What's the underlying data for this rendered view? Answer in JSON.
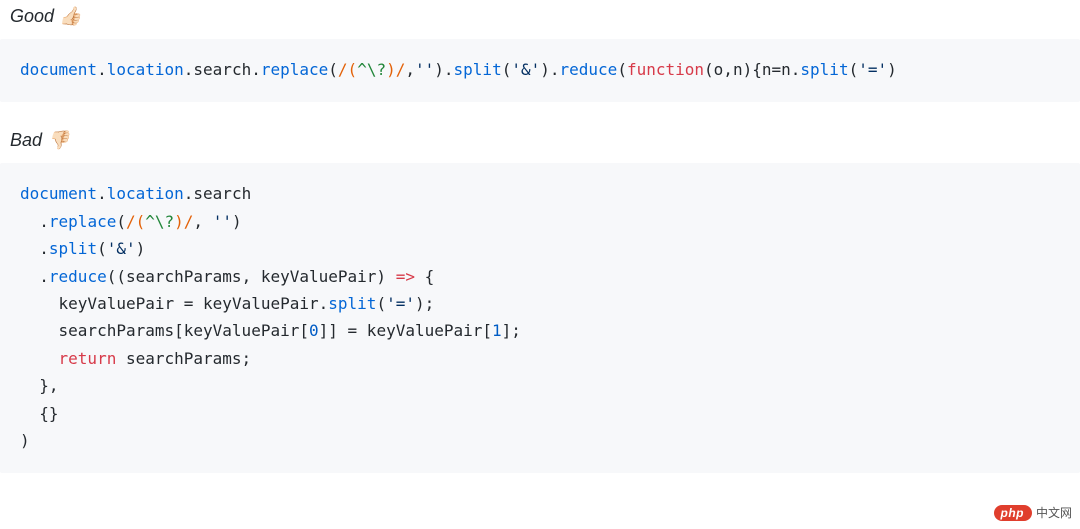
{
  "sections": [
    {
      "label": "Good",
      "emoji_name": "thumbs-up",
      "emoji": "👍🏻",
      "code_tokens": [
        {
          "t": "document",
          "c": "tok-ident"
        },
        {
          "t": ".",
          "c": "tok-plain"
        },
        {
          "t": "location",
          "c": "tok-ident"
        },
        {
          "t": ".",
          "c": "tok-plain"
        },
        {
          "t": "search",
          "c": "tok-plain"
        },
        {
          "t": ".",
          "c": "tok-plain"
        },
        {
          "t": "replace",
          "c": "tok-ident"
        },
        {
          "t": "(",
          "c": "tok-plain"
        },
        {
          "t": "/(",
          "c": "tok-regex"
        },
        {
          "t": "^\\?",
          "c": "tok-escape"
        },
        {
          "t": ")/",
          "c": "tok-regex"
        },
        {
          "t": ",",
          "c": "tok-plain"
        },
        {
          "t": "''",
          "c": "tok-str"
        },
        {
          "t": ").",
          "c": "tok-plain"
        },
        {
          "t": "split",
          "c": "tok-ident"
        },
        {
          "t": "(",
          "c": "tok-plain"
        },
        {
          "t": "'&'",
          "c": "tok-str"
        },
        {
          "t": ").",
          "c": "tok-plain"
        },
        {
          "t": "reduce",
          "c": "tok-ident"
        },
        {
          "t": "(",
          "c": "tok-plain"
        },
        {
          "t": "function",
          "c": "tok-kw"
        },
        {
          "t": "(",
          "c": "tok-plain"
        },
        {
          "t": "o",
          "c": "tok-plain"
        },
        {
          "t": ",",
          "c": "tok-plain"
        },
        {
          "t": "n",
          "c": "tok-plain"
        },
        {
          "t": "){",
          "c": "tok-plain"
        },
        {
          "t": "n",
          "c": "tok-plain"
        },
        {
          "t": "=",
          "c": "tok-plain"
        },
        {
          "t": "n",
          "c": "tok-plain"
        },
        {
          "t": ".",
          "c": "tok-plain"
        },
        {
          "t": "split",
          "c": "tok-ident"
        },
        {
          "t": "(",
          "c": "tok-plain"
        },
        {
          "t": "'='",
          "c": "tok-str"
        },
        {
          "t": ")",
          "c": "tok-plain"
        }
      ]
    },
    {
      "label": "Bad",
      "emoji_name": "thumbs-down",
      "emoji": "👎🏻",
      "code_tokens": [
        {
          "t": "document",
          "c": "tok-ident"
        },
        {
          "t": ".",
          "c": "tok-plain"
        },
        {
          "t": "location",
          "c": "tok-ident"
        },
        {
          "t": ".",
          "c": "tok-plain"
        },
        {
          "t": "search",
          "c": "tok-plain"
        },
        {
          "t": "\n",
          "c": "nl"
        },
        {
          "t": "  .",
          "c": "tok-plain"
        },
        {
          "t": "replace",
          "c": "tok-ident"
        },
        {
          "t": "(",
          "c": "tok-plain"
        },
        {
          "t": "/(",
          "c": "tok-regex"
        },
        {
          "t": "^\\?",
          "c": "tok-escape"
        },
        {
          "t": ")/",
          "c": "tok-regex"
        },
        {
          "t": ", ",
          "c": "tok-plain"
        },
        {
          "t": "''",
          "c": "tok-str"
        },
        {
          "t": ")",
          "c": "tok-plain"
        },
        {
          "t": "\n",
          "c": "nl"
        },
        {
          "t": "  .",
          "c": "tok-plain"
        },
        {
          "t": "split",
          "c": "tok-ident"
        },
        {
          "t": "(",
          "c": "tok-plain"
        },
        {
          "t": "'&'",
          "c": "tok-str"
        },
        {
          "t": ")",
          "c": "tok-plain"
        },
        {
          "t": "\n",
          "c": "nl"
        },
        {
          "t": "  .",
          "c": "tok-plain"
        },
        {
          "t": "reduce",
          "c": "tok-ident"
        },
        {
          "t": "((",
          "c": "tok-plain"
        },
        {
          "t": "searchParams",
          "c": "tok-plain"
        },
        {
          "t": ", ",
          "c": "tok-plain"
        },
        {
          "t": "keyValuePair",
          "c": "tok-plain"
        },
        {
          "t": ") ",
          "c": "tok-plain"
        },
        {
          "t": "=>",
          "c": "tok-kw"
        },
        {
          "t": " {",
          "c": "tok-plain"
        },
        {
          "t": "\n",
          "c": "nl"
        },
        {
          "t": "    keyValuePair ",
          "c": "tok-plain"
        },
        {
          "t": "=",
          "c": "tok-plain"
        },
        {
          "t": " keyValuePair.",
          "c": "tok-plain"
        },
        {
          "t": "split",
          "c": "tok-ident"
        },
        {
          "t": "(",
          "c": "tok-plain"
        },
        {
          "t": "'='",
          "c": "tok-str"
        },
        {
          "t": ");",
          "c": "tok-plain"
        },
        {
          "t": "\n",
          "c": "nl"
        },
        {
          "t": "    searchParams[keyValuePair[",
          "c": "tok-plain"
        },
        {
          "t": "0",
          "c": "tok-num"
        },
        {
          "t": "]] ",
          "c": "tok-plain"
        },
        {
          "t": "=",
          "c": "tok-plain"
        },
        {
          "t": " keyValuePair[",
          "c": "tok-plain"
        },
        {
          "t": "1",
          "c": "tok-num"
        },
        {
          "t": "];",
          "c": "tok-plain"
        },
        {
          "t": "\n",
          "c": "nl"
        },
        {
          "t": "    ",
          "c": "tok-plain"
        },
        {
          "t": "return",
          "c": "tok-kw"
        },
        {
          "t": " searchParams;",
          "c": "tok-plain"
        },
        {
          "t": "\n",
          "c": "nl"
        },
        {
          "t": "  },",
          "c": "tok-plain"
        },
        {
          "t": "\n",
          "c": "nl"
        },
        {
          "t": "  {}",
          "c": "tok-plain"
        },
        {
          "t": "\n",
          "c": "nl"
        },
        {
          "t": ")",
          "c": "tok-plain"
        }
      ]
    }
  ],
  "watermark": {
    "badge": "php",
    "text": "中文网"
  }
}
